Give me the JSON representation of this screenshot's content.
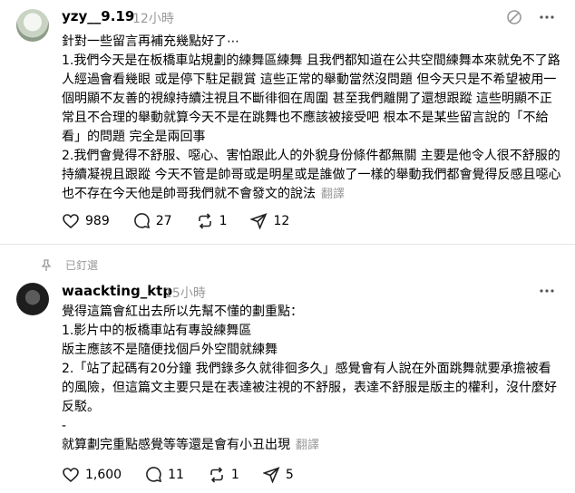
{
  "post1": {
    "username": "yzy__9.19",
    "time": "12小時",
    "lines": [
      "針對一些留言再補充幾點好了⋯",
      "1.我們今天是在板橋車站規劃的練舞區練舞 且我們都知道在公共空間練舞本來就免不了路人經過會看幾眼 或是停下駐足觀賞 這些正常的舉動當然沒問題 但今天只是不希望被用一個明顯不友善的視線持續注視且不斷徘徊在周圍 甚至我們離開了還想跟蹤 這些明顯不正常且不合理的舉動就算今天不是在跳舞也不應該被接受吧 根本不是某些留言說的「不給看」的問題 完全是兩回事",
      "2.我們會覺得不舒服、噁心、害怕跟此人的外貌身份條件都無關 主要是他令人很不舒服的持續凝視且跟蹤 今天不管是帥哥或是明星或是誰做了一樣的舉動我們都會覺得反感且噁心 也不存在今天他是帥哥我們就不會發文的說法"
    ],
    "translate": "翻譯",
    "likes": "989",
    "comments": "27",
    "reposts": "1",
    "shares": "12"
  },
  "pinned_label": "已釘選",
  "post2": {
    "username": "waackting_ktp",
    "time": "15小時",
    "lines": [
      "覺得這篇會紅出去所以先幫不懂的劃重點：",
      "1.影片中的板橋車站有專設練舞區",
      "版主應該不是隨便找個戶外空間就練舞",
      "2.「站了起碼有20分鐘 我們錄多久就徘徊多久」感覺會有人說在外面跳舞就要承擔被看的風險，但這篇文主要只是在表達被注視的不舒服，表達不舒服是版主的權利，沒什麼好反駁。",
      "-",
      "就算劃完重點感覺等等還是會有小丑出現"
    ],
    "translate": "翻譯",
    "likes": "1,600",
    "comments": "11",
    "reposts": "1",
    "shares": "5"
  }
}
